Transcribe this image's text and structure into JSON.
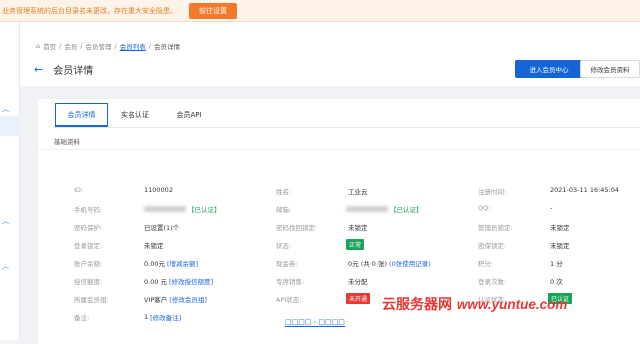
{
  "alert": {
    "text": "业务管理系统的后台目录名未更改，存在重大安全隐患。",
    "button": "前往设置"
  },
  "breadcrumb": {
    "home": "首页",
    "sep": "/",
    "items": [
      "会员",
      "会员管理",
      "会员列表",
      "会员详情"
    ]
  },
  "page": {
    "back_icon": "←",
    "title": "会员详情"
  },
  "actions": {
    "enter": "进入会员中心",
    "edit": "修改会员资料"
  },
  "tabs": [
    "会员详情",
    "实名认证",
    "会员API"
  ],
  "section": "基础资料",
  "rows": [
    [
      {
        "label": "ID:",
        "value": "1100002"
      },
      {
        "label": "姓名:",
        "value": "工业云"
      },
      {
        "label": "注册时间:",
        "value": "2021-03-11 16:45:04"
      }
    ],
    [
      {
        "label": "手机号码:",
        "value": "【已认证】"
      },
      {
        "label": "邮箱:",
        "value": "【已认证】"
      },
      {
        "label": "QQ:",
        "value": "-"
      }
    ],
    [
      {
        "label": "密码保护:",
        "value": "已设置(1)个"
      },
      {
        "label": "密码找回锁定:",
        "value": "未锁定"
      },
      {
        "label": "管理员锁定:",
        "value": "未锁定"
      }
    ],
    [
      {
        "label": "登录锁定:",
        "value": "未锁定"
      },
      {
        "label": "状态:",
        "value": "正常"
      },
      {
        "label": "密保锁定:",
        "value": "未锁定"
      }
    ],
    [
      {
        "label": "账户余额:",
        "value": "0.00元",
        "link": "[增减余额]"
      },
      {
        "label": "现金券:",
        "value": "0元 (共 0 张)",
        "link": "(0张使用记录)"
      },
      {
        "label": "积分:",
        "value": "1 分"
      }
    ],
    [
      {
        "label": "授信额度:",
        "value": "0.00 元",
        "link": "[修改授信额度]"
      },
      {
        "label": "专席销售:",
        "value": "未分配"
      },
      {
        "label": "登录次数:",
        "value": "0 次"
      }
    ],
    [
      {
        "label": "所属会员组:",
        "value": "VIP客户",
        "link": "[修改会员组]"
      },
      {
        "label": "API状态:",
        "value": "未开通"
      },
      {
        "label": "认证状态:",
        "value": "已认证"
      }
    ],
    [
      {
        "label": "备注:",
        "value": "1",
        "link": "[修改备注]"
      }
    ]
  ],
  "watermark": {
    "text": "云服务器网",
    "url": "www.yuntue.com"
  },
  "bottom_link": "□□□□ - □□□□",
  "colors": {
    "primary": "#1665d8",
    "success": "#19a35b",
    "danger": "#e53935",
    "warning": "#f5792a"
  }
}
